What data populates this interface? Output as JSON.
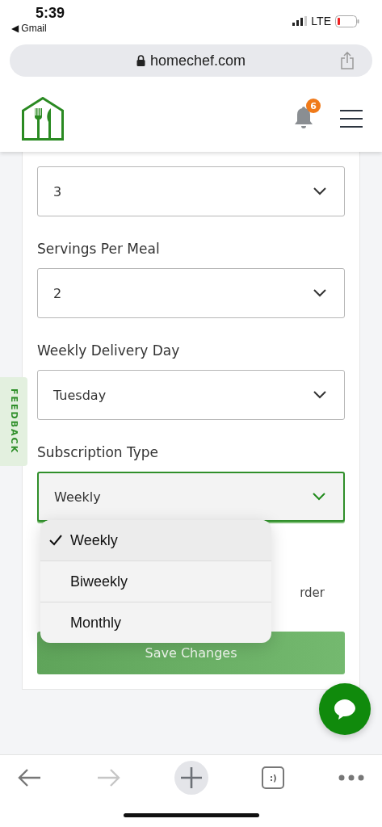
{
  "status_bar": {
    "time": "5:39",
    "back_app": "◀ Gmail",
    "network": "LTE"
  },
  "browser": {
    "url": "homechef.com"
  },
  "header": {
    "notification_count": "6"
  },
  "feedback_tab": {
    "label": "FEEDBACK"
  },
  "fields": [
    {
      "value": "3",
      "focused": false
    },
    {
      "label": "Servings Per Meal",
      "value": "2",
      "focused": false
    },
    {
      "label": "Weekly Delivery Day",
      "value": "Tuesday",
      "focused": false
    },
    {
      "label": "Subscription Type",
      "value": "Weekly",
      "focused": true
    }
  ],
  "dropdown": {
    "options": [
      {
        "label": "Weekly",
        "selected": true
      },
      {
        "label": "Biweekly",
        "selected": false
      },
      {
        "label": "Monthly",
        "selected": false
      }
    ]
  },
  "partly_hidden_text": "rder",
  "save_button": {
    "label": "Save Changes"
  },
  "toolbar": {
    "tabs_label": ":)"
  }
}
